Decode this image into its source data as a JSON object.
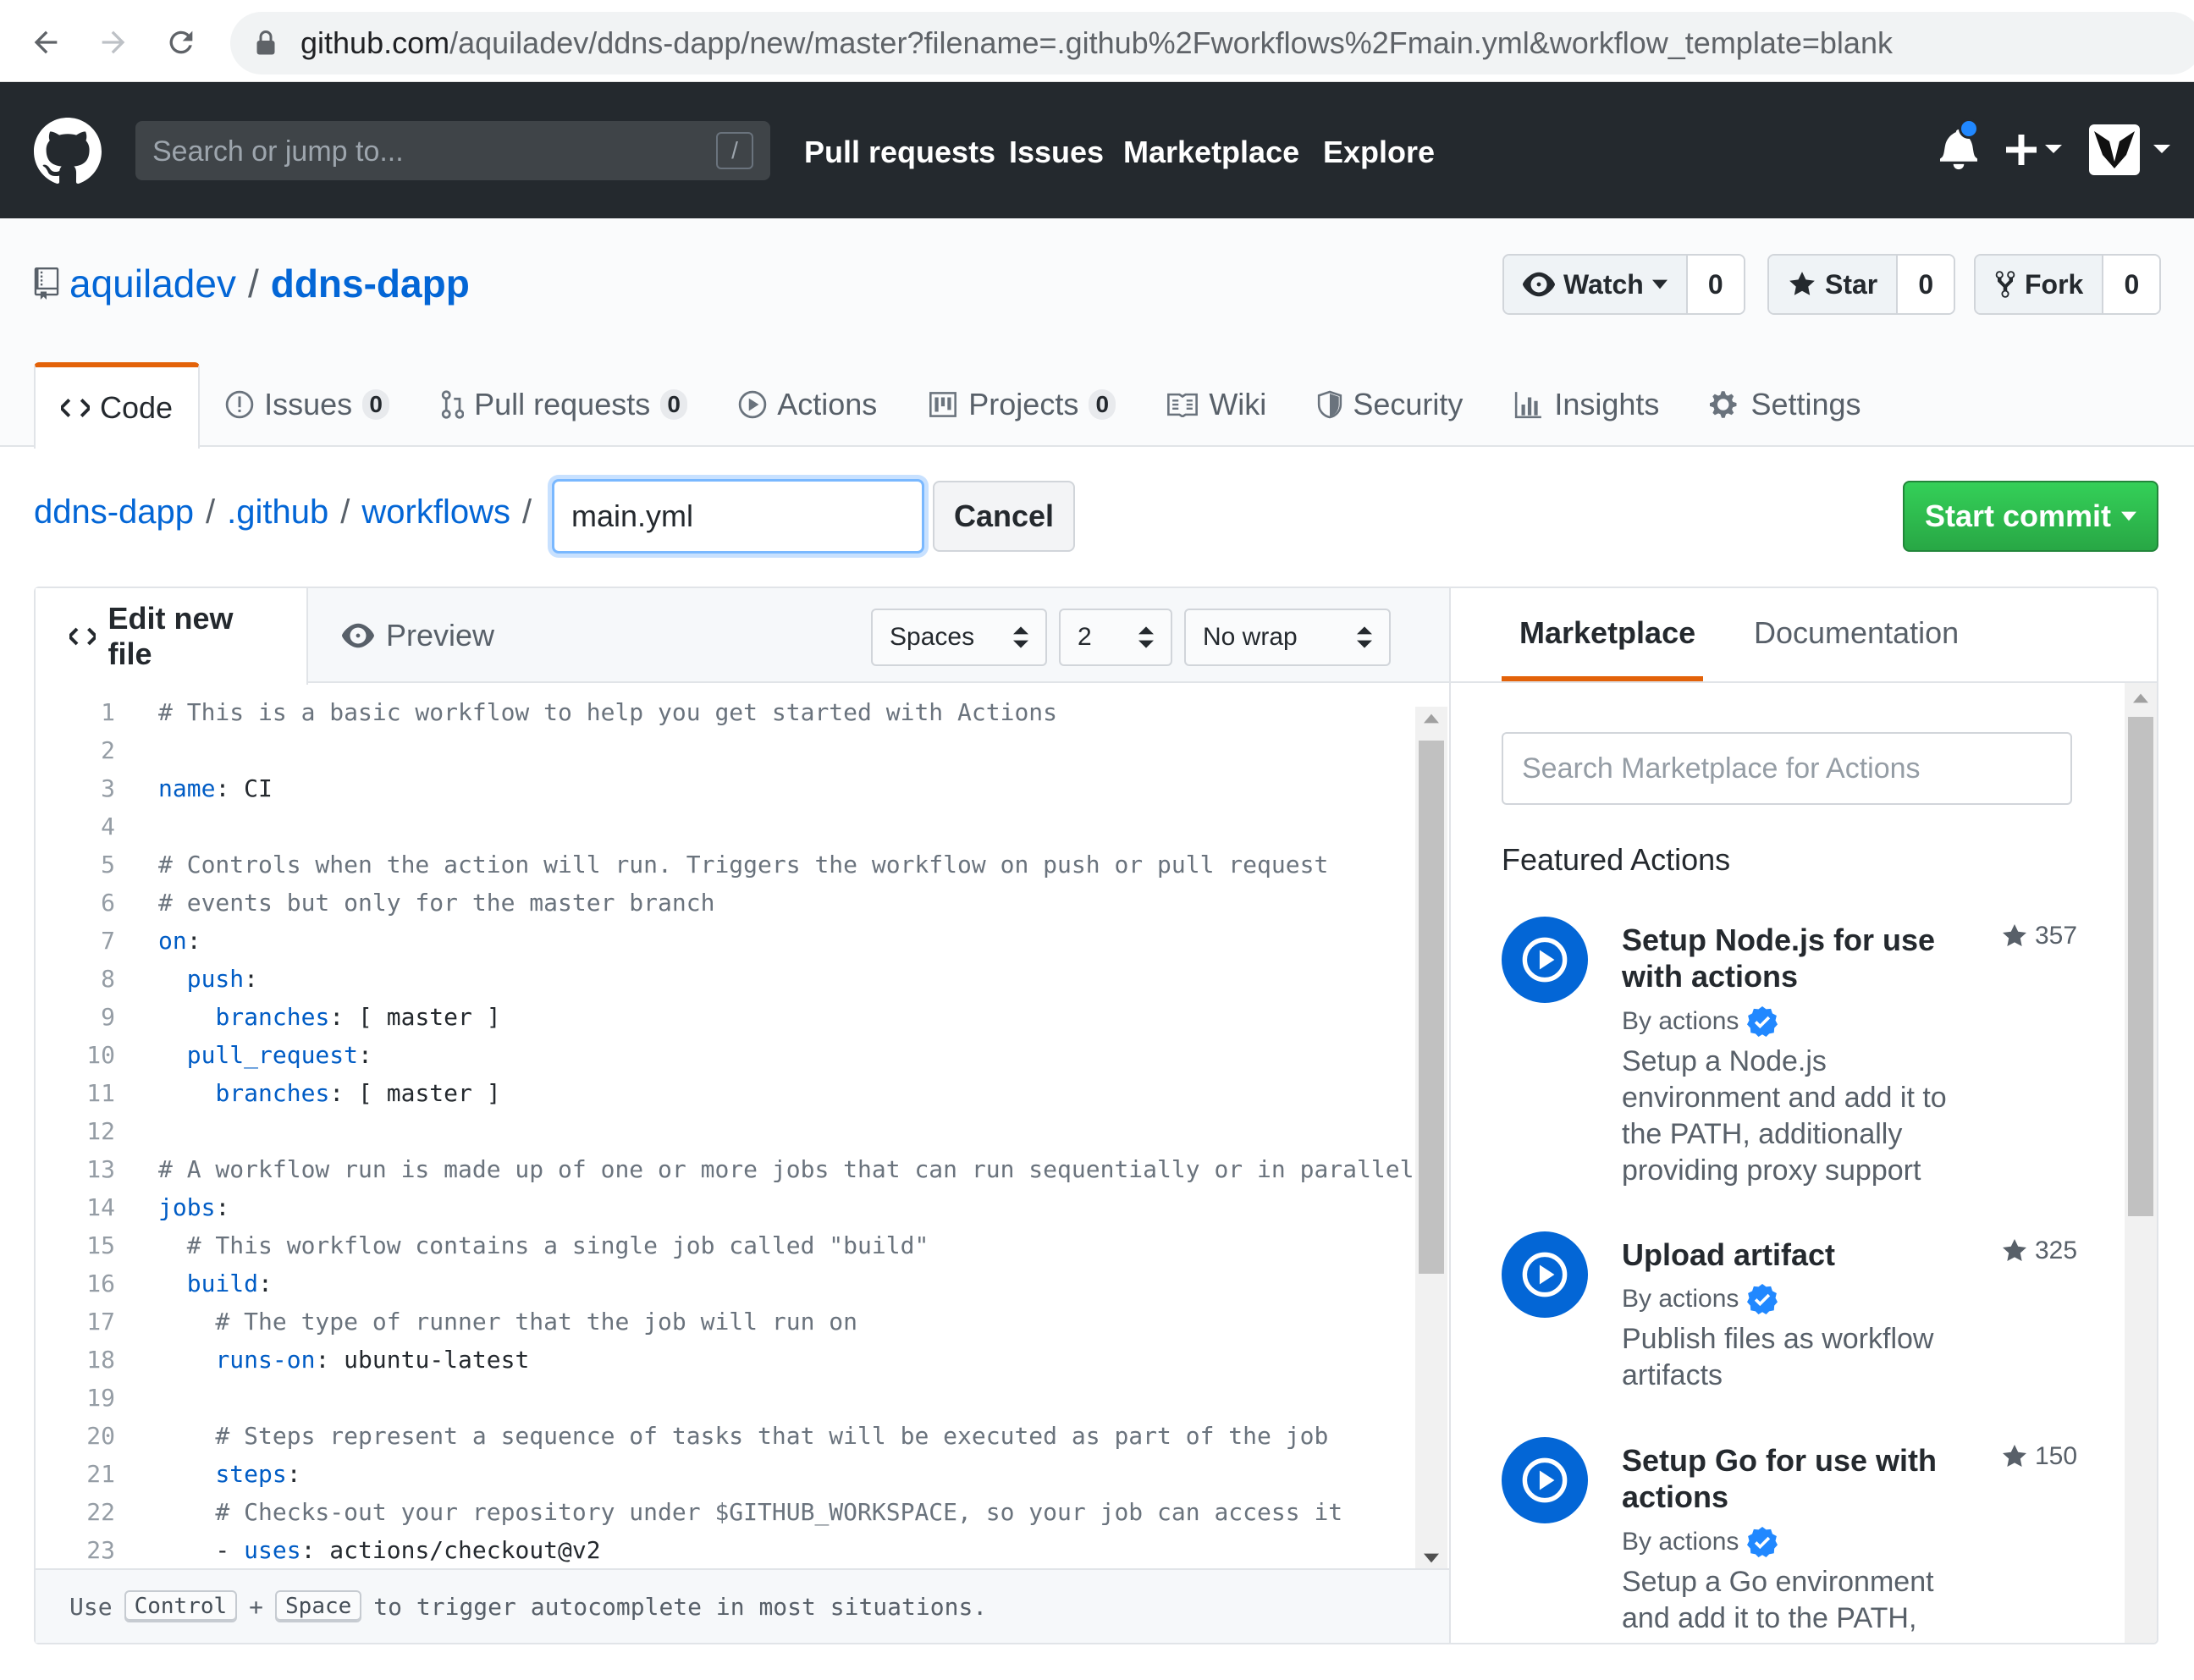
{
  "browser": {
    "url_host": "github.com",
    "url_path": "/aquiladev/ddns-dapp/new/master?filename=.github%2Fworkflows%2Fmain.yml&workflow_template=blank"
  },
  "header": {
    "search_placeholder": "Search or jump to...",
    "search_shortcut": "/",
    "nav": [
      "Pull requests",
      "Issues",
      "Marketplace",
      "Explore"
    ]
  },
  "repo": {
    "owner": "aquiladev",
    "separator": "/",
    "name": "ddns-dapp",
    "watch_label": "Watch",
    "watch_count": "0",
    "star_label": "Star",
    "star_count": "0",
    "fork_label": "Fork",
    "fork_count": "0"
  },
  "tabs": [
    {
      "label": "Code"
    },
    {
      "label": "Issues",
      "count": "0"
    },
    {
      "label": "Pull requests",
      "count": "0"
    },
    {
      "label": "Actions"
    },
    {
      "label": "Projects",
      "count": "0"
    },
    {
      "label": "Wiki"
    },
    {
      "label": "Security"
    },
    {
      "label": "Insights"
    },
    {
      "label": "Settings"
    }
  ],
  "breadcrumb": {
    "root": "ddns-dapp",
    "dir1": ".github",
    "dir2": "workflows",
    "sep": "/",
    "filename_value": "main.yml",
    "cancel_label": "Cancel",
    "commit_label": "Start commit"
  },
  "editor": {
    "tab_edit": "Edit new file",
    "tab_preview": "Preview",
    "indent_mode": "Spaces",
    "indent_size": "2",
    "wrap_mode": "No wrap",
    "footer_use": "Use",
    "footer_key1": "Control",
    "footer_plus": "+",
    "footer_key2": "Space",
    "footer_rest": "to trigger autocomplete in most situations."
  },
  "code_lines": [
    {
      "n": "1",
      "t": "# This is a basic workflow to help you get started with Actions",
      "type": "comment"
    },
    {
      "n": "2",
      "t": "",
      "type": "plain"
    },
    {
      "n": "3",
      "key": "name",
      "rest": ": CI",
      "type": "kv"
    },
    {
      "n": "4",
      "t": "",
      "type": "plain"
    },
    {
      "n": "5",
      "t": "# Controls when the action will run. Triggers the workflow on push or pull request",
      "type": "comment"
    },
    {
      "n": "6",
      "t": "# events but only for the master branch",
      "type": "comment"
    },
    {
      "n": "7",
      "key": "on",
      "rest": ":",
      "type": "kv"
    },
    {
      "n": "8",
      "indent": "  ",
      "key": "push",
      "rest": ":",
      "type": "kv"
    },
    {
      "n": "9",
      "indent": "    ",
      "key": "branches",
      "rest": ": [ master ]",
      "type": "kv"
    },
    {
      "n": "10",
      "indent": "  ",
      "key": "pull_request",
      "rest": ":",
      "type": "kv"
    },
    {
      "n": "11",
      "indent": "    ",
      "key": "branches",
      "rest": ": [ master ]",
      "type": "kv"
    },
    {
      "n": "12",
      "t": "",
      "type": "plain"
    },
    {
      "n": "13",
      "t": "# A workflow run is made up of one or more jobs that can run sequentially or in parallel",
      "type": "comment"
    },
    {
      "n": "14",
      "key": "jobs",
      "rest": ":",
      "type": "kv"
    },
    {
      "n": "15",
      "t": "  # This workflow contains a single job called \"build\"",
      "type": "comment"
    },
    {
      "n": "16",
      "indent": "  ",
      "key": "build",
      "rest": ":",
      "type": "kv"
    },
    {
      "n": "17",
      "t": "    # The type of runner that the job will run on",
      "type": "comment"
    },
    {
      "n": "18",
      "indent": "    ",
      "key": "runs-on",
      "rest": ": ubuntu-latest",
      "type": "kv"
    },
    {
      "n": "19",
      "t": "",
      "type": "plain"
    },
    {
      "n": "20",
      "t": "    # Steps represent a sequence of tasks that will be executed as part of the job",
      "type": "comment"
    },
    {
      "n": "21",
      "indent": "    ",
      "key": "steps",
      "rest": ":",
      "type": "kv"
    },
    {
      "n": "22",
      "t": "    # Checks-out your repository under $GITHUB_WORKSPACE, so your job can access it",
      "type": "comment"
    },
    {
      "n": "23",
      "indent": "    - ",
      "key": "uses",
      "rest": ": actions/checkout@v2",
      "type": "kv"
    }
  ],
  "sidebar": {
    "tab_marketplace": "Marketplace",
    "tab_docs": "Documentation",
    "search_placeholder": "Search Marketplace for Actions",
    "featured_title": "Featured Actions",
    "actions": [
      {
        "title": "Setup Node.js for use with actions",
        "by": "By actions",
        "stars": "357",
        "desc": "Setup a Node.js environment and add it to the PATH, additionally providing proxy support"
      },
      {
        "title": "Upload artifact",
        "by": "By actions",
        "stars": "325",
        "desc": "Publish files as workflow artifacts"
      },
      {
        "title": "Setup Go for use with actions",
        "by": "By actions",
        "stars": "150",
        "desc": "Setup a Go environment and add it to the PATH, additionally providing proxy support"
      }
    ]
  },
  "colors": {
    "header_bg": "#24292e",
    "link": "#0366d6",
    "accent_tab": "#e36209",
    "commit_green": "#28a745",
    "yaml_key": "#005cc5",
    "comment": "#6a737d"
  }
}
